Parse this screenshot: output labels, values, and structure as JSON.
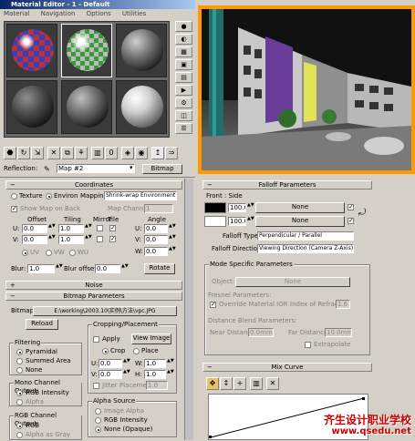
{
  "window": {
    "title": "Material Editor - 1 - Default"
  },
  "menu": [
    "Material",
    "Navigation",
    "Options",
    "Utilities"
  ],
  "reflection": {
    "label": "Reflection:",
    "map_name": "Map #2",
    "type_button": "Bitmap"
  },
  "coordinates": {
    "header": "Coordinates",
    "texture_label": "Texture",
    "environ_label": "Environ",
    "mapping_label": "Mapping:",
    "mapping_value": "Shrink-wrap Environment",
    "show_map_label": "Show Map on Back",
    "map_channel_label": "Map Channel:",
    "map_channel_value": "1",
    "offset_label": "Offset",
    "tiling_label": "Tiling",
    "mirror_label": "Mirror",
    "tile_label": "Tile",
    "angle_label": "Angle",
    "u_label": "U:",
    "v_label": "V:",
    "w_label": "W:",
    "offset_u": "0.0",
    "offset_v": "0.0",
    "tiling_u": "1.0",
    "tiling_v": "1.0",
    "angle_u": "0.0",
    "angle_v": "0.0",
    "angle_w": "0.0",
    "uv_label": "UV",
    "vw_label": "VW",
    "wu_label": "WU",
    "blur_label": "Blur:",
    "blur_value": "1.0",
    "blur_offset_label": "Blur offset:",
    "blur_offset_value": "0.0",
    "rotate_button": "Rotate"
  },
  "noise": {
    "header": "Noise"
  },
  "bitmap_params": {
    "header": "Bitmap Parameters",
    "bitmap_label": "Bitmap:",
    "bitmap_path": "E:\\working\\2003.10\\实例\\方法\\vpc.JPG",
    "reload_button": "Reload",
    "cropping_title": "Cropping/Placement",
    "apply_label": "Apply",
    "view_image_button": "View Image",
    "crop_label": "Crop",
    "place_label": "Place",
    "u_label": "U:",
    "v_label": "V:",
    "w_label": "W:",
    "h_label": "H:",
    "crop_u": "0.0",
    "crop_v": "0.0",
    "crop_w": "1.0",
    "crop_h": "1.0",
    "jitter_label": "Jitter Placement:",
    "jitter_value": "1.0",
    "filtering_title": "Filtering",
    "pyramidal_label": "Pyramidal",
    "summed_label": "Summed Area",
    "none_label": "None",
    "mono_title": "Mono Channel Output:",
    "rgb_intensity_label": "RGB Intensity",
    "alpha_label": "Alpha",
    "rgb_channel_title": "RGB Channel Output:",
    "rgb_label": "RGB",
    "alpha_as_gray_label": "Alpha as Gray",
    "alpha_source_title": "Alpha Source",
    "image_alpha_label": "Image Alpha",
    "rgb_intensity2_label": "RGB Intensity",
    "none_opaque_label": "None (Opaque)"
  },
  "falloff": {
    "header": "Falloff Parameters",
    "front_side_label": "Front : Side",
    "value1": "100.0",
    "value2": "100.0",
    "map1": "None",
    "map2": "None",
    "falloff_type_label": "Falloff Type:",
    "falloff_type_value": "Perpendicular / Parallel",
    "falloff_direction_label": "Falloff Direction:",
    "falloff_direction_value": "Viewing Direction (Camera Z-Axis)"
  },
  "mode_specific": {
    "header": "Mode Specific Parameters",
    "object_label": "Object:",
    "object_value": "None",
    "fresnel_title": "Fresnel Parameters:",
    "override_label": "Override Material IOR",
    "ior_label": "Index of Refraction",
    "ior_value": "1.6",
    "distance_title": "Distance Blend Parameters:",
    "near_label": "Near Distance:",
    "near_value": "0.0mm",
    "far_label": "Far Distance:",
    "far_value": "10.0mm",
    "extrapolate_label": "Extrapolate"
  },
  "mix_curve": {
    "header": "Mix Curve"
  },
  "watermark": {
    "line1": "齐生设计职业学校",
    "line2": "www.qsedu.net"
  },
  "colors": {
    "viewport_border": "#ff9900",
    "title_start": "#0a246a",
    "title_end": "#a6caf0",
    "watermark": "#cc0000"
  }
}
